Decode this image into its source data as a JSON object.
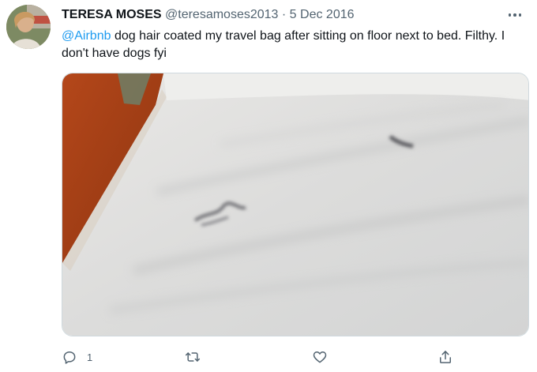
{
  "tweet": {
    "author_name": "TERESA MOSES",
    "handle": "@teresamoses2013",
    "separator": "·",
    "date": "5 Dec 2016",
    "mention": "@Airbnb",
    "body_text": " dog hair coated my travel bag after sitting on floor next to bed. Filthy. I don't have dogs fyi"
  },
  "actions": {
    "reply_count": "1",
    "retweet_count": "",
    "like_count": ""
  },
  "icons": {
    "more": "more-horizontal-icon",
    "reply": "reply-icon",
    "retweet": "retweet-icon",
    "like": "heart-icon",
    "share": "share-icon"
  },
  "colors": {
    "link": "#1d9bf0",
    "secondary_text": "#536471",
    "primary_text": "#0f1419"
  }
}
